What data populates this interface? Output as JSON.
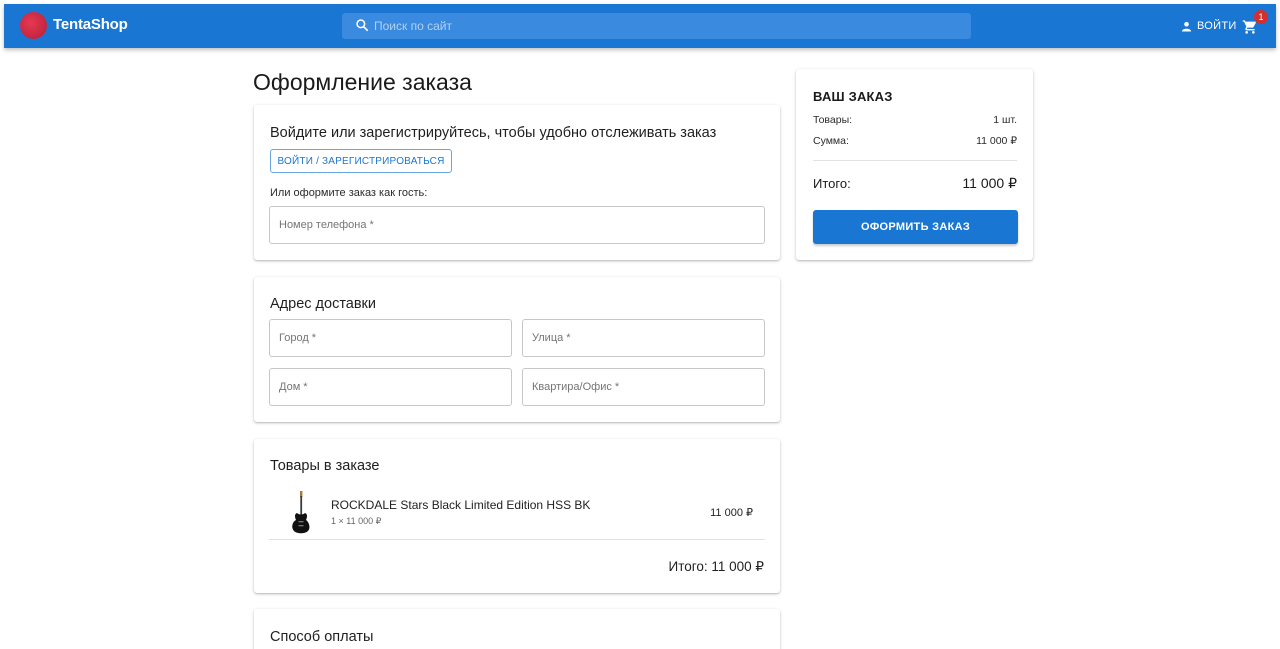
{
  "header": {
    "brand": "TentaShop",
    "search_placeholder": "Поиск по сайт",
    "login_label": "Войти",
    "cart_count": "1"
  },
  "page": {
    "title": "Оформление заказа"
  },
  "auth_card": {
    "heading": "Войдите или зарегистрируйтесь, чтобы удобно отслеживать заказ",
    "login_register_button": "Войти / Зарегистрироваться",
    "guest_text": "Или оформите заказ как гость:",
    "phone_placeholder": "Номер телефона *"
  },
  "address_card": {
    "heading": "Адрес доставки",
    "city_placeholder": "Город *",
    "street_placeholder": "Улица *",
    "house_placeholder": "Дом *",
    "apartment_placeholder": "Квартира/Офис *"
  },
  "items_card": {
    "heading": "Товары в заказе",
    "items": [
      {
        "name": "ROCKDALE Stars Black Limited Edition HSS BK",
        "quantity_line": "1 × 11 000 ₽",
        "price": "11 000 ₽"
      }
    ],
    "total_label": "Итого: 11 000 ₽"
  },
  "payment_card": {
    "heading": "Способ оплаты"
  },
  "summary": {
    "heading": "ВАШ ЗАКАЗ",
    "goods_label": "Товары:",
    "goods_value": "1 шт.",
    "sum_label": "Сумма:",
    "sum_value": "11 000 ₽",
    "total_label": "Итого:",
    "total_value": "11 000 ₽",
    "submit_button": "Оформить заказ"
  },
  "colors": {
    "primary": "#1976d2",
    "badge": "#d32f2f",
    "logo": "#e53950"
  }
}
